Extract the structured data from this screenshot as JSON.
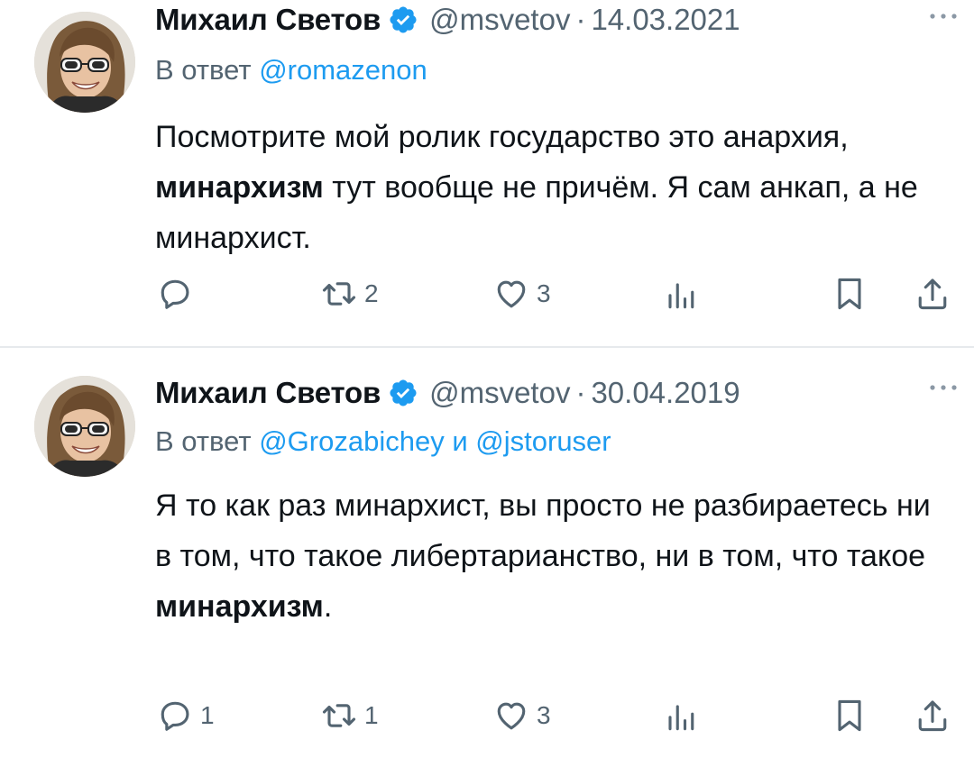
{
  "tweets": [
    {
      "author_name": "Михаил Светов",
      "handle": "@msvetov",
      "separator": "·",
      "date": "14.03.2021",
      "reply_prefix": "В ответ",
      "reply_mentions": [
        "@romazenon"
      ],
      "reply_joiner": "",
      "text_parts": [
        "Посмотрите мой ролик государство это анархия, ",
        "минархизм",
        " тут вообще не причём. Я сам анкап, а не минархист."
      ],
      "counts": {
        "replies": "",
        "retweets": "2",
        "likes": "3"
      }
    },
    {
      "author_name": "Михаил Светов",
      "handle": "@msvetov",
      "separator": "·",
      "date": "30.04.2019",
      "reply_prefix": "В ответ",
      "reply_mentions": [
        "@Grozabichey",
        "@jstoruser"
      ],
      "reply_joiner": "и",
      "text_parts": [
        "Я то как раз минархист, вы просто не разбираетесь ни в том, что такое либертарианство, ни в том, что такое ",
        "минархизм",
        "."
      ],
      "counts": {
        "replies": "1",
        "retweets": "1",
        "likes": "3"
      }
    }
  ],
  "icons": {
    "verified": "verified-badge-icon",
    "more": "more-dots-icon",
    "reply": "reply-bubble-icon",
    "retweet": "retweet-arrows-icon",
    "like": "heart-icon",
    "views": "views-bars-icon",
    "bookmark": "bookmark-icon",
    "share": "share-upload-icon"
  },
  "colors": {
    "text": "#0f1419",
    "secondary": "#536471",
    "link": "#1d9bf0",
    "verified": "#1d9bf0",
    "divider": "#e6e9ec"
  }
}
